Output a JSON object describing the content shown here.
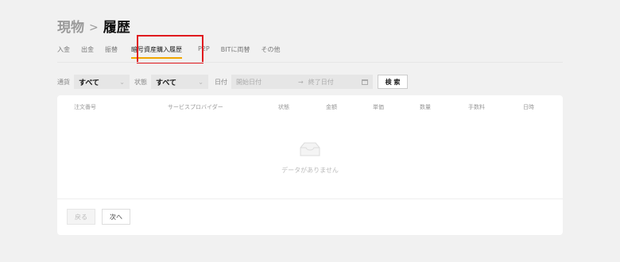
{
  "breadcrumb": {
    "parent": "現物",
    "separator": ">",
    "current": "履歴"
  },
  "tabs": [
    {
      "label": "入金",
      "active": false
    },
    {
      "label": "出金",
      "active": false
    },
    {
      "label": "振替",
      "active": false
    },
    {
      "label": "暗号資産購入履歴",
      "active": true
    },
    {
      "label": "P2P",
      "active": false
    },
    {
      "label": "BITに両替",
      "active": false
    },
    {
      "label": "その他",
      "active": false
    }
  ],
  "filters": {
    "currency_label": "通貨",
    "currency_value": "すべて",
    "status_label": "状態",
    "status_value": "すべて",
    "date_label": "日付",
    "start_placeholder": "開始日付",
    "end_placeholder": "終了日付",
    "search_button": "検 索"
  },
  "table": {
    "columns": [
      "注文番号",
      "サービスプロバイダー",
      "状態",
      "金額",
      "単価",
      "数量",
      "手数料",
      "日時"
    ],
    "empty_text": "データがありません"
  },
  "pagination": {
    "prev": "戻る",
    "next": "次へ"
  },
  "colors": {
    "accent": "#f0a500",
    "highlight": "#e0191e",
    "background": "#f1f1f1"
  }
}
